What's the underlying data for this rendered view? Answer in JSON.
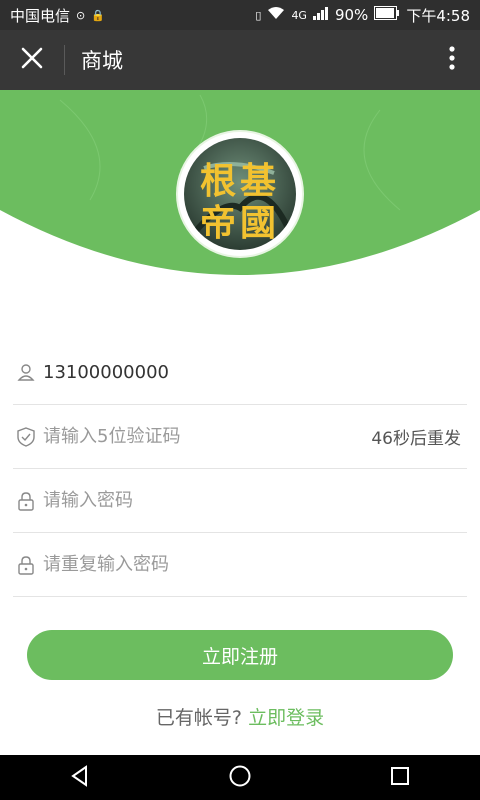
{
  "status_bar": {
    "carrier": "中国电信",
    "network_tag": "4G",
    "battery": "90%",
    "time": "下午4:58"
  },
  "header": {
    "title": "商城"
  },
  "logo": {
    "text_line1": "根基",
    "text_line2": "帝國"
  },
  "form": {
    "phone_value": "13100000000",
    "code_placeholder": "请输入5位验证码",
    "resend_label": "46秒后重发",
    "password_placeholder": "请输入密码",
    "password_repeat_placeholder": "请重复输入密码"
  },
  "actions": {
    "register_label": "立即注册",
    "have_account_text": "已有帐号?",
    "login_link": "立即登录"
  },
  "colors": {
    "accent": "#6cbd5f",
    "header_bg": "#373737",
    "status_bg": "#2f2f2f"
  },
  "icons": [
    "close-icon",
    "more-vertical-icon",
    "user-icon",
    "shield-check-icon",
    "lock-icon",
    "back-triangle-icon",
    "home-circle-icon",
    "recent-square-icon"
  ]
}
